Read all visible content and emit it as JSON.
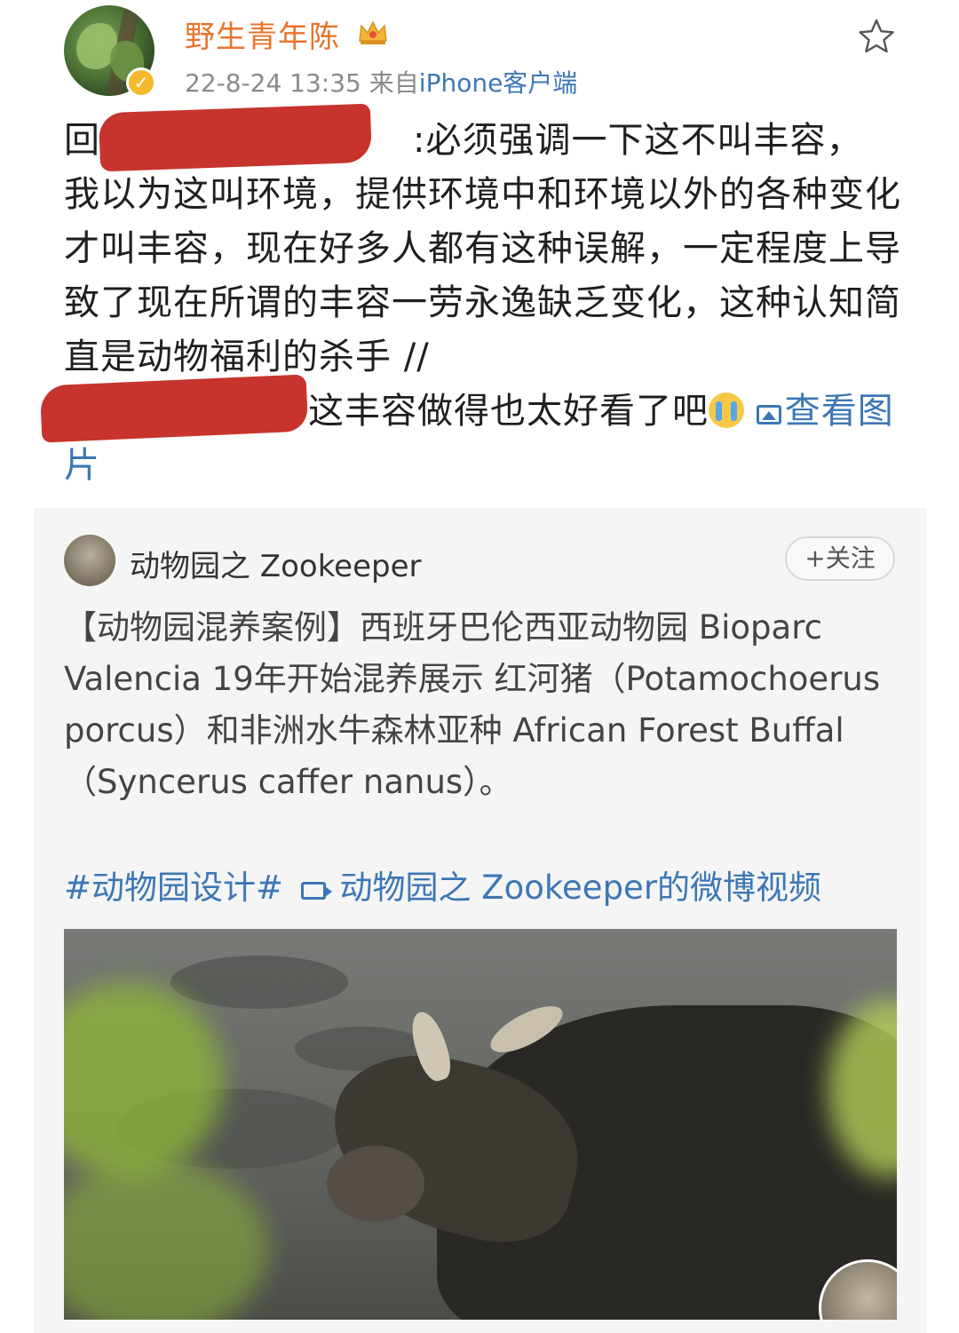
{
  "post": {
    "username": "野生青年陈",
    "timestamp": "22-8-24 13:35",
    "source_prefix": "来自",
    "source": "iPhone客户端",
    "text_line1_prefix": "回",
    "text_line1": ":必须强调一下这不叫丰容，",
    "text_body": "我以为这叫环境，提供环境中和环境以外的各种变化才叫丰容，现在好多人都有这种误解，一定程度上导致了现在所谓的丰容一劳永逸缺乏变化，这种认知简直是动物福利的杀手 //",
    "text_quoted": "这丰容做得也太好看了吧",
    "view_image_label": "查看图片"
  },
  "card": {
    "author": "动物园之 Zookeeper",
    "follow_label": "+关注",
    "text": "【动物园混养案例】西班牙巴伦西亚动物园 Bioparc Valencia 19年开始混养展示 红河猪（Potamochoerus porcus）和非洲水牛森林亚种 African Forest Buffal（Syncerus caffer nanus）。",
    "hashtag": "#动物园设计#",
    "video_link": "动物园之 Zookeeper的微博视频"
  },
  "icons": {
    "crown": "crown-icon",
    "star": "star-icon",
    "verified": "verified-badge-icon",
    "image": "image-icon",
    "video": "video-icon",
    "emoji": "crying-emoji-icon"
  },
  "colors": {
    "username": "#e8742c",
    "link": "#3d77b5",
    "redaction": "#c3251e",
    "card_bg": "#f5f5f5"
  }
}
